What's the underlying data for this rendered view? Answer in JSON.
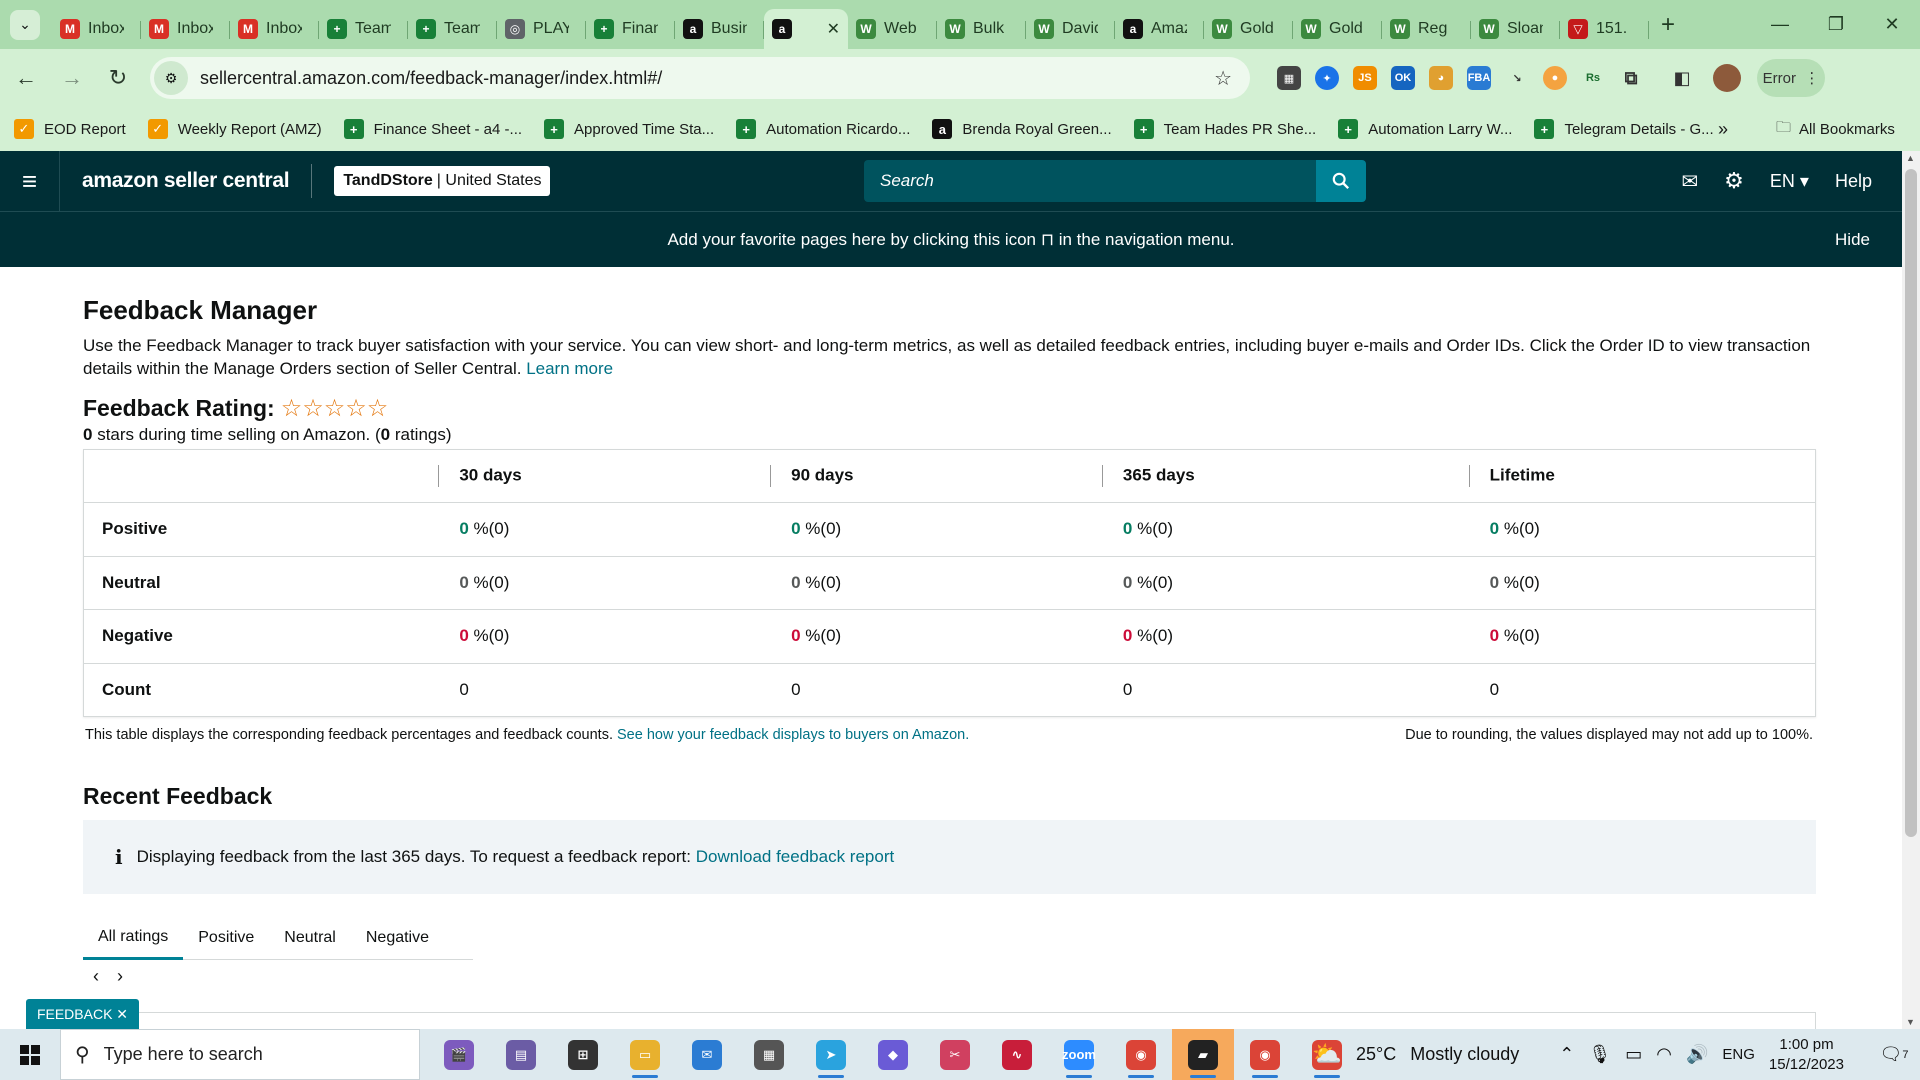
{
  "browser": {
    "tabs": [
      {
        "title": "Inbox",
        "icon": "gmail-icon",
        "color": "#d93025",
        "glyph": "M"
      },
      {
        "title": "Inbox",
        "icon": "gmail-icon",
        "color": "#d93025",
        "glyph": "M"
      },
      {
        "title": "Inbox",
        "icon": "gmail-icon",
        "color": "#d93025",
        "glyph": "M"
      },
      {
        "title": "Team",
        "icon": "sheets-icon",
        "color": "#188038",
        "glyph": "+"
      },
      {
        "title": "Team",
        "icon": "sheets-icon",
        "color": "#188038",
        "glyph": "+"
      },
      {
        "title": "PLAY",
        "icon": "play-icon",
        "color": "#5f6368",
        "glyph": "◎"
      },
      {
        "title": "Finance",
        "icon": "sheets-icon",
        "color": "#188038",
        "glyph": "+"
      },
      {
        "title": "Business",
        "icon": "amazon-icon",
        "color": "#111111",
        "glyph": "a"
      },
      {
        "title": "",
        "icon": "amazon-icon",
        "color": "#111111",
        "glyph": "a"
      },
      {
        "title": "Web",
        "icon": "w-icon",
        "color": "#3c8a3f",
        "glyph": "W"
      },
      {
        "title": "Bulk",
        "icon": "w-icon",
        "color": "#3c8a3f",
        "glyph": "W"
      },
      {
        "title": "David",
        "icon": "w-icon",
        "color": "#3c8a3f",
        "glyph": "W"
      },
      {
        "title": "Amazon",
        "icon": "amazon-icon",
        "color": "#111111",
        "glyph": "a"
      },
      {
        "title": "Gold",
        "icon": "w-icon",
        "color": "#3c8a3f",
        "glyph": "W"
      },
      {
        "title": "Gold",
        "icon": "w-icon",
        "color": "#3c8a3f",
        "glyph": "W"
      },
      {
        "title": "Reg",
        "icon": "w-icon",
        "color": "#3c8a3f",
        "glyph": "W"
      },
      {
        "title": "Sloan",
        "icon": "w-icon",
        "color": "#3c8a3f",
        "glyph": "W"
      },
      {
        "title": "151.",
        "icon": "vivaldi-icon",
        "color": "#c41a1a",
        "glyph": "▽"
      }
    ],
    "url": "sellercentral.amazon.com/feedback-manager/index.html#/",
    "error_label": "Error",
    "bookmarks": [
      {
        "label": "EOD Report",
        "color": "#f29900",
        "glyph": "✓"
      },
      {
        "label": "Weekly Report (AMZ)",
        "color": "#f29900",
        "glyph": "✓"
      },
      {
        "label": "Finance Sheet - a4 -...",
        "color": "#188038",
        "glyph": "+"
      },
      {
        "label": "Approved Time Sta...",
        "color": "#188038",
        "glyph": "+"
      },
      {
        "label": "Automation Ricardo...",
        "color": "#188038",
        "glyph": "+"
      },
      {
        "label": "Brenda Royal Green...",
        "color": "#111111",
        "glyph": "a"
      },
      {
        "label": "Team Hades PR She...",
        "color": "#188038",
        "glyph": "+"
      },
      {
        "label": "Automation Larry W...",
        "color": "#188038",
        "glyph": "+"
      },
      {
        "label": "Telegram Details - G...",
        "color": "#188038",
        "glyph": "+"
      }
    ],
    "all_bookmarks_label": "All Bookmarks"
  },
  "header": {
    "logo_text": "amazon seller central",
    "store_name": "TandDStore",
    "store_region": "United States",
    "search_placeholder": "Search",
    "language": "EN",
    "help_label": "Help",
    "favorites_banner": "Add your favorite pages here by clicking this icon",
    "favorites_banner_suffix": "in the navigation menu.",
    "hide_label": "Hide"
  },
  "page": {
    "title": "Feedback Manager",
    "description": "Use the Feedback Manager to track buyer satisfaction with your service. You can view short- and long-term metrics, as well as detailed feedback entries, including buyer e-mails and Order IDs. Click the Order ID to view transaction details within the Manage Orders section of Seller Central.",
    "learn_more": "Learn more",
    "rating_title": "Feedback Rating:",
    "rating_stars": 0,
    "rating_summary_stars": "0",
    "rating_summary_text": " stars during time selling on Amazon. (",
    "rating_summary_count": "0",
    "rating_summary_end": " ratings)"
  },
  "feedback_table": {
    "columns": [
      "30 days",
      "90 days",
      "365 days",
      "Lifetime"
    ],
    "rows": [
      {
        "label": "Positive",
        "kind": "green",
        "cells": [
          [
            "0",
            " %(0)"
          ],
          [
            "0",
            " %(0)"
          ],
          [
            "0",
            " %(0)"
          ],
          [
            "0",
            " %(0)"
          ]
        ]
      },
      {
        "label": "Neutral",
        "kind": "neutral",
        "cells": [
          [
            "0",
            " %(0)"
          ],
          [
            "0",
            " %(0)"
          ],
          [
            "0",
            " %(0)"
          ],
          [
            "0",
            " %(0)"
          ]
        ]
      },
      {
        "label": "Negative",
        "kind": "red",
        "cells": [
          [
            "0",
            " %(0)"
          ],
          [
            "0",
            " %(0)"
          ],
          [
            "0",
            " %(0)"
          ],
          [
            "0",
            " %(0)"
          ]
        ]
      },
      {
        "label": "Count",
        "kind": "plain",
        "cells": [
          [
            "0",
            ""
          ],
          [
            "0",
            ""
          ],
          [
            "0",
            ""
          ],
          [
            "0",
            ""
          ]
        ]
      }
    ],
    "footnote": "This table displays the corresponding feedback percentages and feedback counts.",
    "footnote_link": "See how your feedback displays to buyers on Amazon.",
    "rounding_note": "Due to rounding, the values displayed may not add up to 100%."
  },
  "recent": {
    "title": "Recent Feedback",
    "info_text": "Displaying feedback from the last 365 days. To request a feedback report:",
    "info_link": "Download feedback report",
    "tabs": [
      "All ratings",
      "Positive",
      "Neutral",
      "Negative"
    ],
    "active_tab": 0,
    "feedback_button": "FEEDBACK ✕"
  },
  "taskbar": {
    "search_placeholder": "Type here to search",
    "weather_temp": "25°C",
    "weather_text": "Mostly cloudy",
    "language": "ENG",
    "time": "1:00 pm",
    "date": "15/12/2023",
    "notification_count": "7",
    "apps": [
      {
        "name": "clapper-icon",
        "color": "#7d5bbe",
        "glyph": "🎬"
      },
      {
        "name": "notes-icon",
        "color": "#6b5ca5",
        "glyph": "▤"
      },
      {
        "name": "taskview-icon",
        "color": "#333333",
        "glyph": "⊞"
      },
      {
        "name": "file-explorer-icon",
        "color": "#e8b12e",
        "glyph": "▭"
      },
      {
        "name": "mail-icon",
        "color": "#2b7cd3",
        "glyph": "✉"
      },
      {
        "name": "calculator-icon",
        "color": "#555555",
        "glyph": "▦"
      },
      {
        "name": "telegram-icon",
        "color": "#2aa3de",
        "glyph": "➤"
      },
      {
        "name": "copilot-icon",
        "color": "#6a5bd6",
        "glyph": "◆"
      },
      {
        "name": "snipping-icon",
        "color": "#d04060",
        "glyph": "✂"
      },
      {
        "name": "stocks-icon",
        "color": "#c81e3a",
        "glyph": "∿"
      },
      {
        "name": "zoom-icon",
        "color": "#2d8cff",
        "glyph": "zoom"
      },
      {
        "name": "chrome-icon",
        "color": "#db4437",
        "glyph": "◉"
      },
      {
        "name": "sticky-notes-icon",
        "color": "#222222",
        "glyph": "▰"
      },
      {
        "name": "chrome-profile-icon",
        "color": "#db4437",
        "glyph": "◉"
      },
      {
        "name": "chrome-profile2-icon",
        "color": "#db4437",
        "glyph": "◉"
      }
    ]
  }
}
